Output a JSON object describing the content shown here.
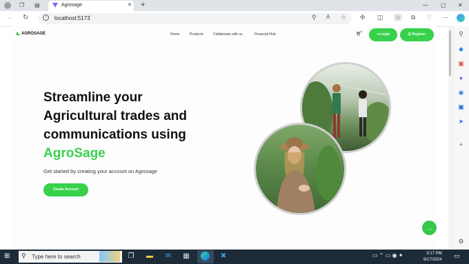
{
  "browser": {
    "tab_title": "Agrosage",
    "url": "localhost:5173",
    "window_controls": [
      "—",
      "▢",
      "✕"
    ]
  },
  "site": {
    "logo": "AGROSAGE",
    "nav": [
      "Home",
      "Products",
      "Collaborate with us",
      "Financial Hub"
    ],
    "cart_count": "0",
    "login_label": "Login",
    "register_label": "Register",
    "hero": {
      "line1": "Streamline your",
      "line2": "Agricultural trades and",
      "line3": "communications using",
      "accent": "AgroSage",
      "subtitle": "Get started by creating your account on Agrosage",
      "cta": "Create Account"
    },
    "accent_color": "#37d14b"
  },
  "taskbar": {
    "search_placeholder": "Type here to search",
    "time": "3:17 PM",
    "date": "6/17/2024"
  }
}
